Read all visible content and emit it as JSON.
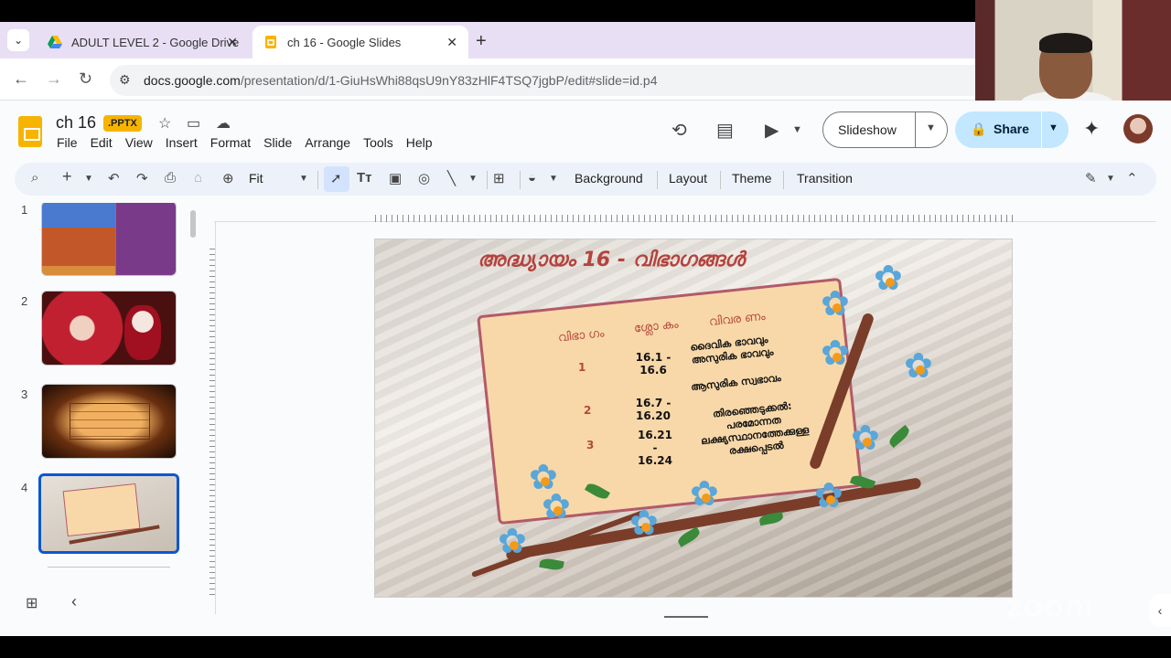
{
  "browser": {
    "tabs": [
      {
        "title": "ADULT LEVEL 2 - Google Drive",
        "icon": "google-drive-icon",
        "active": false
      },
      {
        "title": "ch 16 - Google Slides",
        "icon": "google-slides-icon",
        "active": true
      }
    ],
    "url_domain": "docs.google.com",
    "url_path": "/presentation/d/1-GiuHsWhi88qsU9nY83zHlF4TSQ7jgbP/edit#slide=id.p4"
  },
  "doc": {
    "title": "ch 16",
    "badge": ".PPTX",
    "menu": [
      "File",
      "Edit",
      "View",
      "Insert",
      "Format",
      "Slide",
      "Arrange",
      "Tools",
      "Help"
    ]
  },
  "header": {
    "slideshow_label": "Slideshow",
    "share_label": "Share"
  },
  "toolbar": {
    "zoom": "Fit",
    "background": "Background",
    "layout": "Layout",
    "theme": "Theme",
    "transition": "Transition"
  },
  "filmstrip": {
    "numbers": [
      "1",
      "2",
      "3",
      "4"
    ],
    "selected": "4"
  },
  "slide": {
    "title": "അദ്ധ്യായം 16 -  വിഭാഗങ്ങൾ",
    "headers": [
      "വിഭാ ഗം",
      "ശ്ലോ കം",
      "വിവര ണം"
    ],
    "rows": [
      {
        "num": "1",
        "verse": "16.1 - 16.6",
        "desc": "ദൈവിക ഭാവവും അസുരിക ഭാവവും"
      },
      {
        "num": "2",
        "verse": "16.7 - 16.20",
        "desc": "ആസുരിക സ്വഭാവം"
      },
      {
        "num": "3",
        "verse": "16.21 - 16.24",
        "desc": "തിരഞ്ഞെടുക്കൽ: പരമോന്നത ലക്ഷ്യസ്ഥാനത്തേക്കുള്ള രക്ഷപ്പെടൽ"
      }
    ]
  },
  "watermark": "zoom",
  "colors": {
    "accent": "#0b57d0",
    "share_bg": "#c2e7ff",
    "slides_yellow": "#f6b400"
  }
}
